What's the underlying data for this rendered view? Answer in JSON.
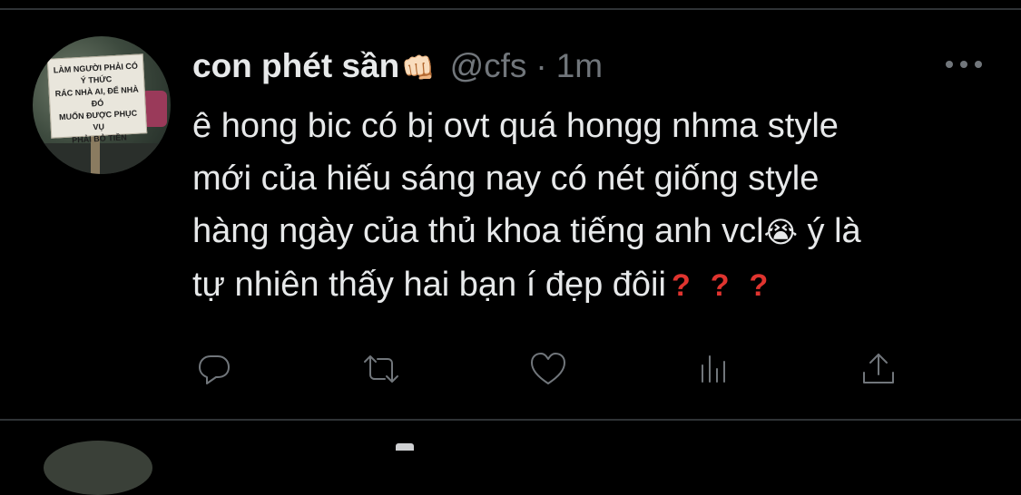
{
  "tweet": {
    "display_name": "con phét sần",
    "name_emoji": "👊🏻",
    "handle": "@cfs",
    "separator": "·",
    "time": "1m",
    "avatar_sign_text": "LÀM NGƯỜI PHẢI CÓ Ý THỨC\nRÁC NHÀ AI, ĐỂ NHÀ ĐÓ\nMUỐN ĐƯỢC PHỤC VỤ\nPHẢI BỎ TIỀN",
    "text_lines": [
      "ê hong bic có bị ovt quá hongg nhma style",
      "mới của hiếu sáng nay có nét giống style",
      "hàng ngày của thủ khoa tiếng anh vcl",
      "tự nhiên thấy hai bạn í đẹp đôii"
    ],
    "line3_emoji": "😭",
    "line3_tail": " ý là",
    "question_marks": [
      "?",
      "?",
      "?"
    ]
  },
  "actions": {
    "reply_icon": "reply-icon",
    "retweet_icon": "retweet-icon",
    "like_icon": "heart-icon",
    "views_icon": "views-icon",
    "share_icon": "share-icon",
    "more_icon": "more-horizontal-icon"
  },
  "colors": {
    "background": "#000000",
    "text": "#e7e9ea",
    "secondary": "#71767b",
    "divider": "#2f3336",
    "question_mark": "#e0342f"
  }
}
